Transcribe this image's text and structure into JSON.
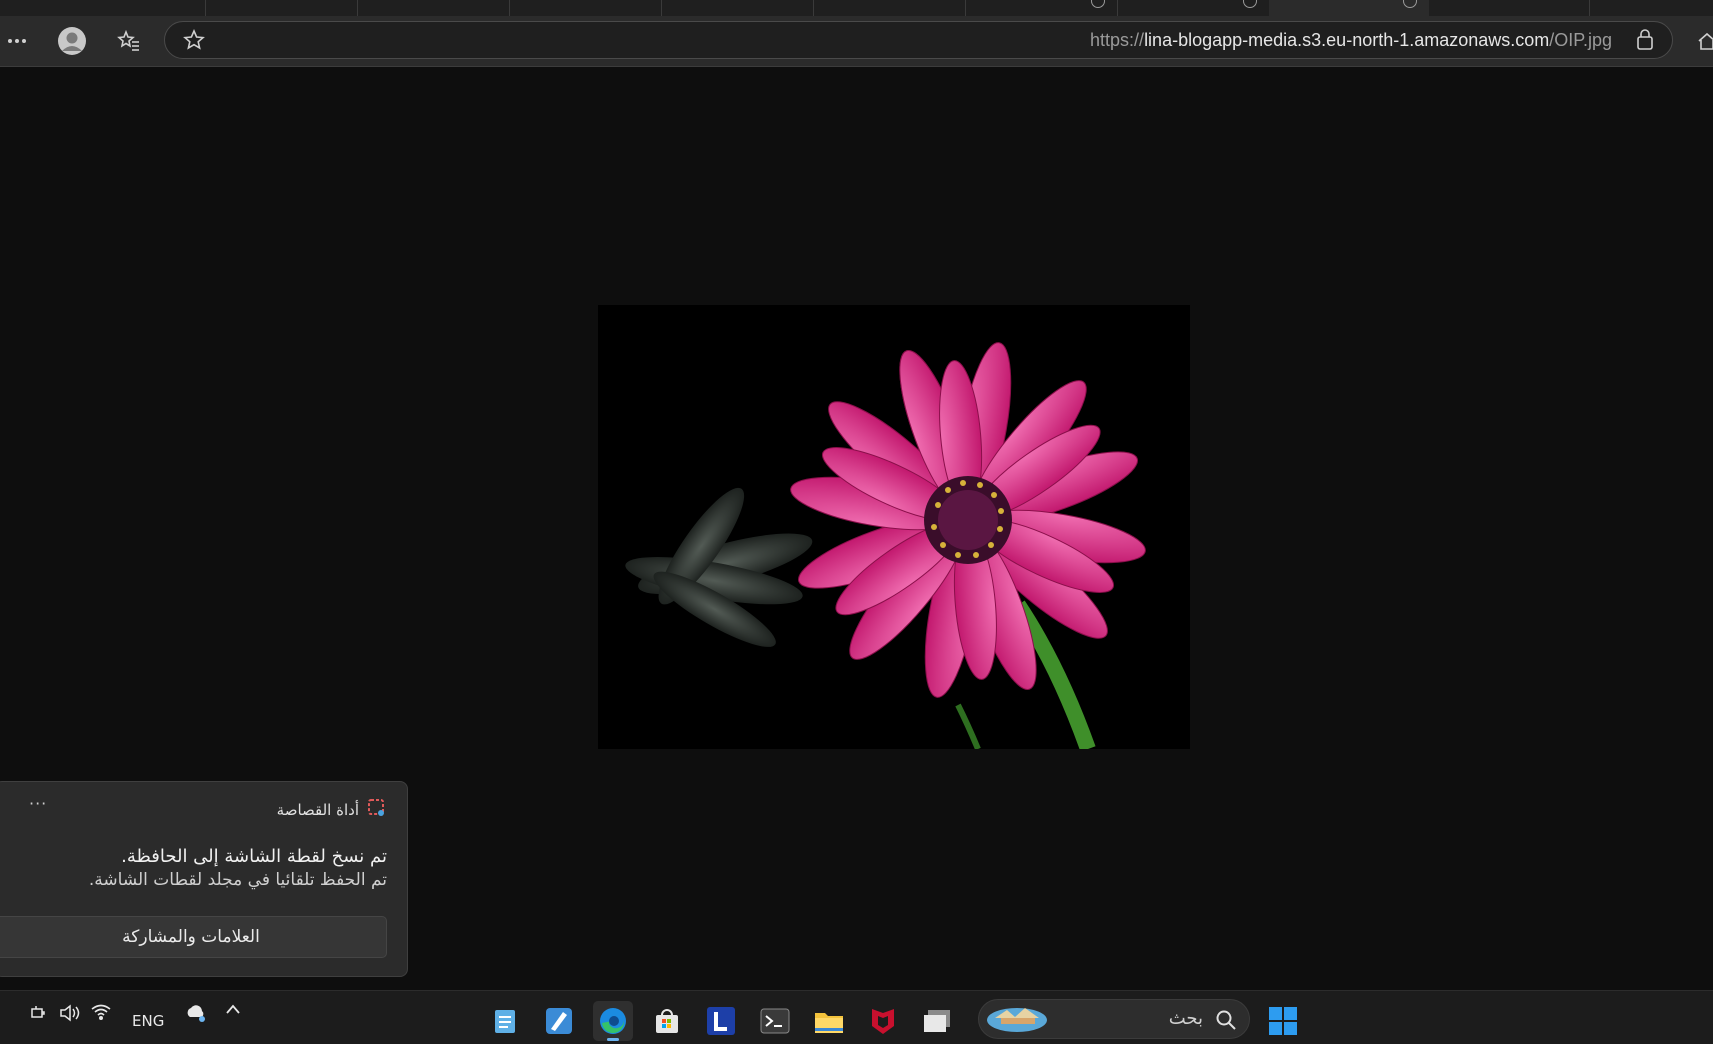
{
  "browser": {
    "url_scheme": "https://",
    "url_host": "lina-blogapp-media.s3.eu-north-1.amazonaws.com",
    "url_path": "/OIP.jpg",
    "tab_count": 11
  },
  "viewer": {
    "image_alt": "pink daisy flower on black background"
  },
  "notification": {
    "app_name": "أداة القصاصة",
    "more_label": "···",
    "line1": "تم نسخ لقطة الشاشة إلى الحافظة.",
    "line2": "تم الحفظ تلقائيا في مجلد لقطات الشاشة.",
    "button_label": "العلامات والمشاركة"
  },
  "taskbar": {
    "language": "ENG",
    "search_placeholder": "بحث",
    "apps": [
      "notepad-icon",
      "pen-app-icon",
      "edge-icon",
      "store-icon",
      "l-app-icon",
      "terminal-icon",
      "file-explorer-icon",
      "mcafee-icon",
      "app-window-icon"
    ]
  }
}
